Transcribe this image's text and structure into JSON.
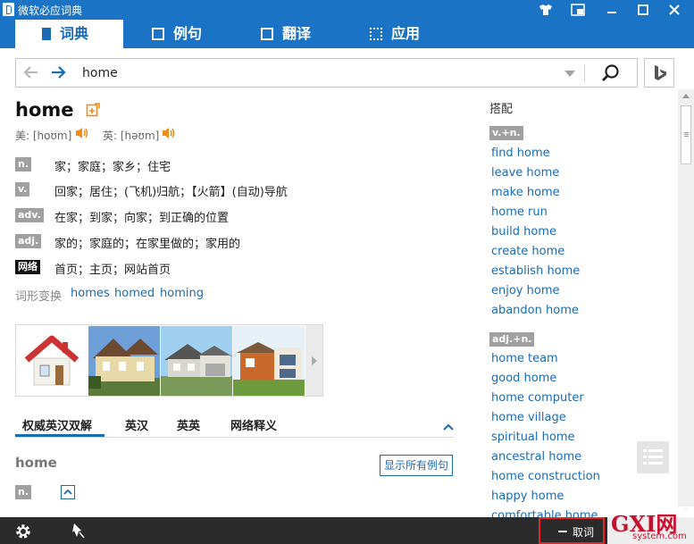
{
  "window": {
    "title": "微软必应词典",
    "accent": "#1a73c4"
  },
  "tabs": [
    {
      "label": "词典",
      "icon": "dictionary-icon",
      "active": true
    },
    {
      "label": "例句",
      "icon": "sentences-icon",
      "active": false
    },
    {
      "label": "翻译",
      "icon": "translate-icon",
      "active": false
    },
    {
      "label": "应用",
      "icon": "apps-icon",
      "active": false
    }
  ],
  "search": {
    "value": "home"
  },
  "entry": {
    "headword": "home",
    "pron_us_label": "美: [hoʊm]",
    "pron_uk_label": "英: [həʊm]",
    "definitions": [
      {
        "pos": "n.",
        "text": "家；家庭；家乡；住宅"
      },
      {
        "pos": "v.",
        "text": "回家；居住；(飞机)归航；【火箭】(自动)导航"
      },
      {
        "pos": "adv.",
        "text": "在家；到家；向家；到正确的位置"
      },
      {
        "pos": "adj.",
        "text": "家的；家庭的；在家里做的；家用的"
      },
      {
        "pos": "网络",
        "text": "首页；主页；网站首页"
      }
    ],
    "inflections_label": "词形变换",
    "inflections": [
      "homes",
      "homed",
      "homing"
    ]
  },
  "subtabs": [
    "权威英汉双解",
    "英汉",
    "英英",
    "网络释义"
  ],
  "detail": {
    "headword": "home",
    "show_examples_button": "显示所有例句",
    "pos": "n."
  },
  "collocations": {
    "heading": "搭配",
    "groups": [
      {
        "label": "v.+n.",
        "items": [
          "find home",
          "leave home",
          "make home",
          "home run",
          "build home",
          "create home",
          "establish home",
          "enjoy home",
          "abandon home"
        ]
      },
      {
        "label": "adj.+n.",
        "items": [
          "home team",
          "good home",
          "home computer",
          "home village",
          "spiritual home",
          "ancestral home",
          "home construction",
          "happy home",
          "comfortable home"
        ]
      }
    ]
  },
  "bottom": {
    "cancel_label": "取词"
  },
  "watermark": {
    "text": "GXI网",
    "sub": "system.com"
  }
}
